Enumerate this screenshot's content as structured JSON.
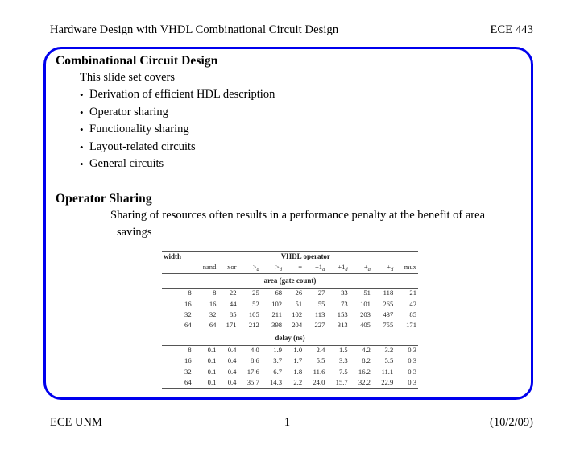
{
  "header": {
    "title": "Hardware Design with VHDL Combinational Circuit Design",
    "course": "ECE 443"
  },
  "slide": {
    "border_color": "#0000ee",
    "section_title": "Combinational Circuit Design",
    "lead": "This slide set covers",
    "bullets": [
      "Derivation of efficient HDL description",
      "Operator sharing",
      "Functionality sharing",
      "Layout-related circuits",
      "General circuits"
    ],
    "second_title": "Operator Sharing",
    "body_line1": "Sharing of resources often results in a performance penalty at the benefit of area",
    "body_line2": "savings"
  },
  "chart_data": {
    "type": "table",
    "title": "VHDL operator",
    "row_label_header": "width",
    "columns": [
      "nand",
      "xor",
      ">a",
      ">d",
      "=",
      "+1a",
      "+1d",
      "+a",
      "+d",
      "mux"
    ],
    "column_labels_html": [
      "nand",
      "xor",
      "&gt;<sub>a</sub>",
      "&gt;<sub>d</sub>",
      "=",
      "+1<sub>a</sub>",
      "+1<sub>d</sub>",
      "+<sub>a</sub>",
      "+<sub>d</sub>",
      "mux"
    ],
    "sections": [
      {
        "name": "area (gate count)",
        "rows": [
          {
            "width": "8",
            "values": [
              "8",
              "22",
              "25",
              "68",
              "26",
              "27",
              "33",
              "51",
              "118",
              "21"
            ]
          },
          {
            "width": "16",
            "values": [
              "16",
              "44",
              "52",
              "102",
              "51",
              "55",
              "73",
              "101",
              "265",
              "42"
            ]
          },
          {
            "width": "32",
            "values": [
              "32",
              "85",
              "105",
              "211",
              "102",
              "113",
              "153",
              "203",
              "437",
              "85"
            ]
          },
          {
            "width": "64",
            "values": [
              "64",
              "171",
              "212",
              "398",
              "204",
              "227",
              "313",
              "405",
              "755",
              "171"
            ]
          }
        ]
      },
      {
        "name": "delay (ns)",
        "rows": [
          {
            "width": "8",
            "values": [
              "0.1",
              "0.4",
              "4.0",
              "1.9",
              "1.0",
              "2.4",
              "1.5",
              "4.2",
              "3.2",
              "0.3"
            ]
          },
          {
            "width": "16",
            "values": [
              "0.1",
              "0.4",
              "8.6",
              "3.7",
              "1.7",
              "5.5",
              "3.3",
              "8.2",
              "5.5",
              "0.3"
            ]
          },
          {
            "width": "32",
            "values": [
              "0.1",
              "0.4",
              "17.6",
              "6.7",
              "1.8",
              "11.6",
              "7.5",
              "16.2",
              "11.1",
              "0.3"
            ]
          },
          {
            "width": "64",
            "values": [
              "0.1",
              "0.4",
              "35.7",
              "14.3",
              "2.2",
              "24.0",
              "15.7",
              "32.2",
              "22.9",
              "0.3"
            ]
          }
        ]
      }
    ]
  },
  "footer": {
    "left": "ECE UNM",
    "page": "1",
    "date": "(10/2/09)"
  }
}
